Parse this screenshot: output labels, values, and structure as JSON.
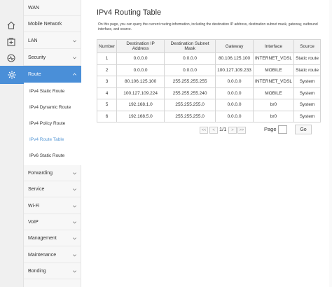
{
  "rail": {
    "icons": [
      "home-icon",
      "plus-box-icon",
      "status-gauge-icon",
      "settings-gear-icon"
    ]
  },
  "menu": {
    "wan": "WAN",
    "mobile_network": "Mobile Network",
    "lan": "LAN",
    "security": "Security",
    "route": "Route",
    "forwarding": "Forwarding",
    "service": "Service",
    "wifi": "Wi-Fi",
    "voip": "VoIP",
    "management": "Management",
    "maintenance": "Maintenance",
    "bonding": "Bonding"
  },
  "route_submenu": {
    "ipv4_static": "IPv4 Static Route",
    "ipv4_dynamic": "IPv4 Dynamic Route",
    "ipv4_policy": "IPv4 Policy Route",
    "ipv4_table": "IPv4 Route Table",
    "ipv6_static": "IPv6 Static Route"
  },
  "page": {
    "title": "IPv4 Routing Table",
    "description": "On this page, you can query the current routing information, including the destination IP address, destination subnet mask, gateway, outbound interface, and source."
  },
  "table": {
    "headers": {
      "number": "Number",
      "dest_ip": "Destination IP Address",
      "dest_mask": "Destination Subnet Mask",
      "gateway": "Gateway",
      "interface": "Interface",
      "source": "Source"
    },
    "rows": [
      {
        "n": "1",
        "ip": "0.0.0.0",
        "mask": "0.0.0.0",
        "gw": "80.106.125.100",
        "if": "INTERNET_VDSL",
        "src": "Static route"
      },
      {
        "n": "2",
        "ip": "0.0.0.0",
        "mask": "0.0.0.0",
        "gw": "100.127.109.233",
        "if": "MOBILE",
        "src": "Static route"
      },
      {
        "n": "3",
        "ip": "80.106.125.100",
        "mask": "255.255.255.255",
        "gw": "0.0.0.0",
        "if": "INTERNET_VDSL",
        "src": "System"
      },
      {
        "n": "4",
        "ip": "100.127.109.224",
        "mask": "255.255.255.240",
        "gw": "0.0.0.0",
        "if": "MOBILE",
        "src": "System"
      },
      {
        "n": "5",
        "ip": "192.168.1.0",
        "mask": "255.255.255.0",
        "gw": "0.0.0.0",
        "if": "br0",
        "src": "System"
      },
      {
        "n": "6",
        "ip": "192.168.5.0",
        "mask": "255.255.255.0",
        "gw": "0.0.0.0",
        "if": "br0",
        "src": "System"
      }
    ]
  },
  "pager": {
    "first": "<<",
    "prev": "<",
    "current": "1/1",
    "next": ">",
    "last": ">>",
    "page_label": "Page",
    "go": "Go"
  }
}
